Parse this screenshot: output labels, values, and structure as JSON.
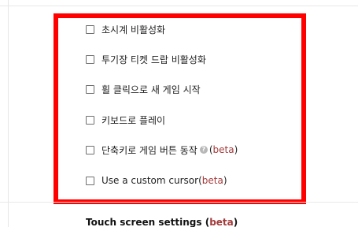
{
  "options": [
    {
      "label": "초시계 비활성화",
      "checked": false
    },
    {
      "label": "투기장 티켓 드랍 비활성화",
      "checked": false
    },
    {
      "label": "휠 클릭으로 새 게임 시작",
      "checked": false
    },
    {
      "label": "키보드로 플레이",
      "checked": false
    },
    {
      "label": "단축키로 게임 버튼 동작",
      "checked": false,
      "help_icon": "?",
      "open_paren": "(",
      "beta": "beta",
      "close_paren": ")"
    },
    {
      "label": "Use a custom cursor ",
      "checked": false,
      "open_paren": "(",
      "beta": "beta",
      "close_paren": ")"
    }
  ],
  "touch_section": {
    "title": "Touch screen settings ",
    "open_paren": "(",
    "beta": "beta",
    "close_paren": ")"
  },
  "colors": {
    "highlight": "#ff0000",
    "beta": "#a33a3a"
  }
}
